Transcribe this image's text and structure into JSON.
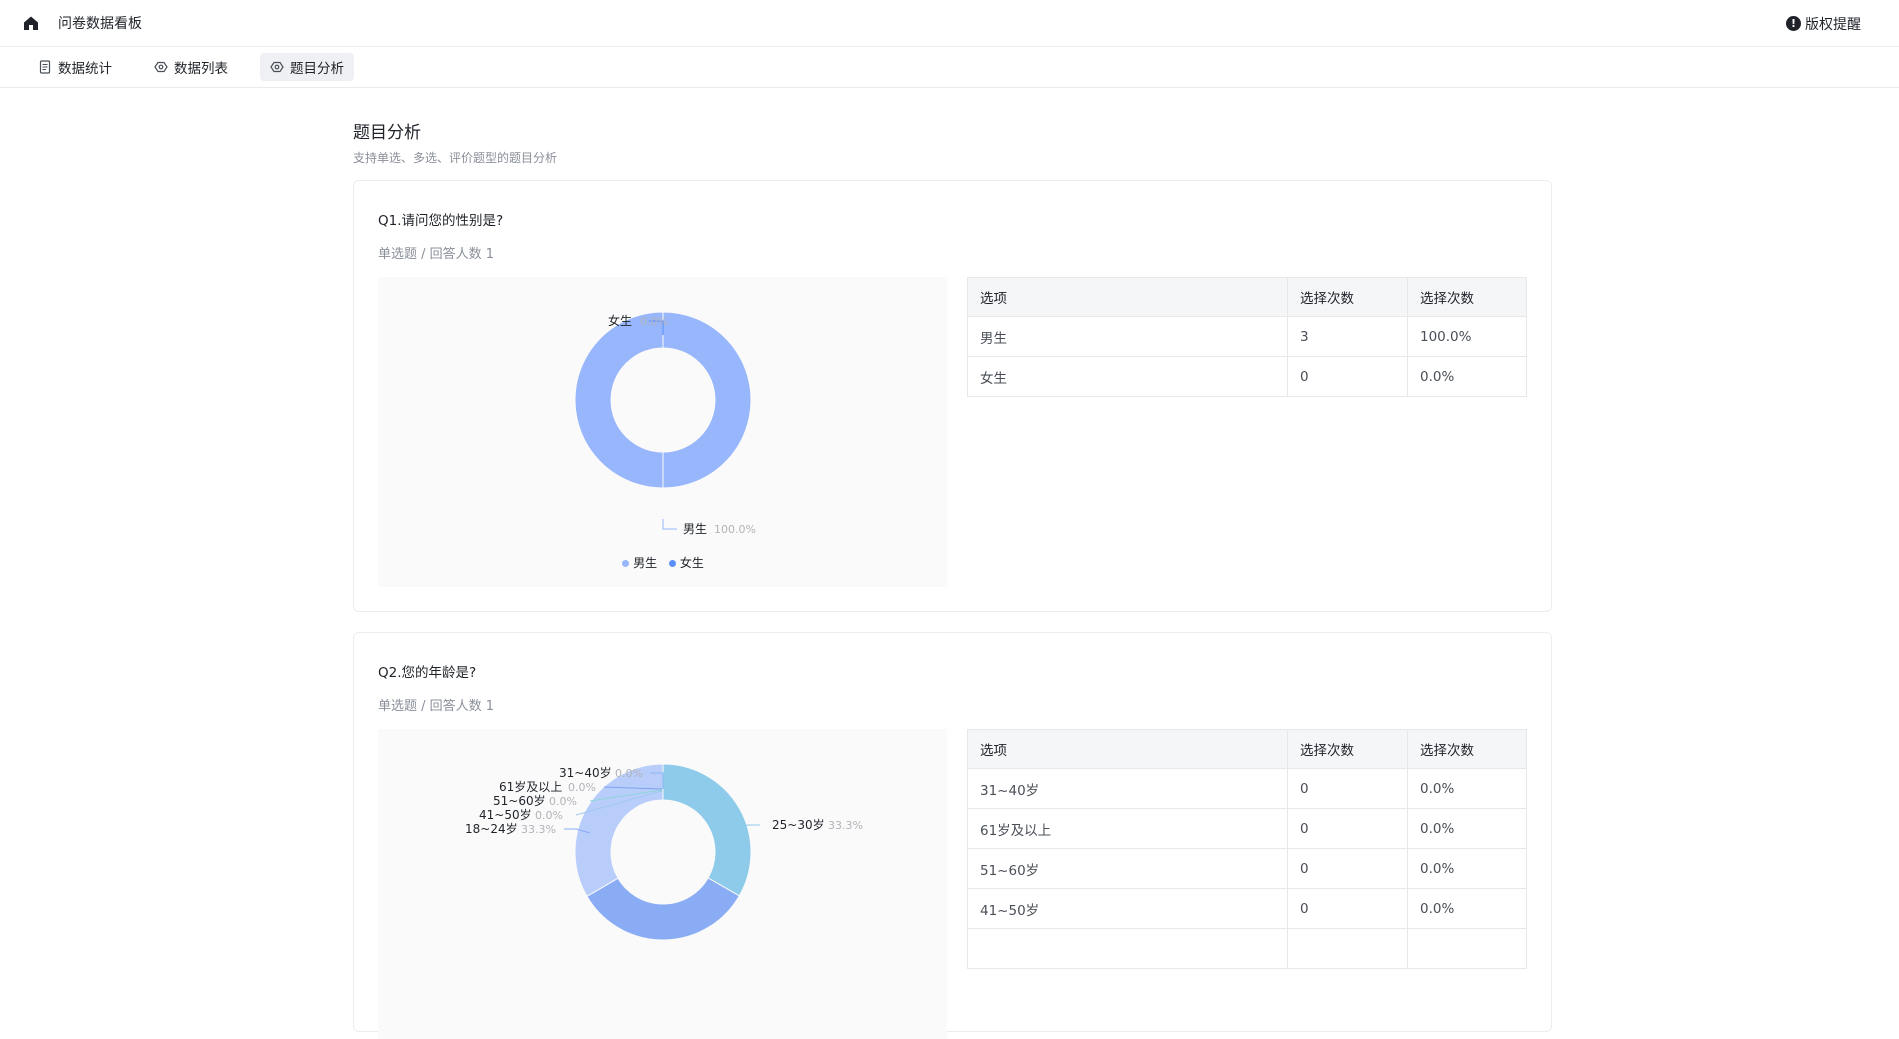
{
  "header": {
    "title": "问卷数据看板",
    "notice_label": "版权提醒",
    "notice_icon_glyph": "!"
  },
  "tabs": [
    {
      "label": "数据统计",
      "icon": "document-icon",
      "active": false
    },
    {
      "label": "数据列表",
      "icon": "eye-icon",
      "active": false
    },
    {
      "label": "题目分析",
      "icon": "eye-icon",
      "active": true
    }
  ],
  "page": {
    "title": "题目分析",
    "subtitle": "支持单选、多选、评价题型的题目分析"
  },
  "questions": [
    {
      "title": "Q1.请问您的性别是?",
      "meta": "单选题 / 回答人数 1",
      "table": {
        "headers": [
          "选项",
          "选择次数",
          "选择次数"
        ],
        "rows": [
          [
            "男生",
            "3",
            "100.0%"
          ],
          [
            "女生",
            "0",
            "0.0%"
          ]
        ]
      },
      "legend": [
        "男生",
        "女生"
      ]
    },
    {
      "title": "Q2.您的年龄是?",
      "meta": "单选题 / 回答人数 1",
      "table": {
        "headers": [
          "选项",
          "选择次数",
          "选择次数"
        ],
        "rows": [
          [
            "31~40岁",
            "0",
            "0.0%"
          ],
          [
            "61岁及以上",
            "0",
            "0.0%"
          ],
          [
            "51~60岁",
            "0",
            "0.0%"
          ],
          [
            "41~50岁",
            "0",
            "0.0%"
          ]
        ]
      }
    }
  ],
  "chart_data": [
    {
      "type": "pie",
      "slices": [
        {
          "name": "男生",
          "value": 100.0,
          "label": "100.0%",
          "color": "#97b6fb"
        },
        {
          "name": "女生",
          "value": 0.0,
          "label": "0.0%",
          "color": "#5b8ff9"
        }
      ],
      "legend": "bottom"
    },
    {
      "type": "pie",
      "slices": [
        {
          "name": "25~30岁",
          "value": 33.3,
          "label": "33.3%",
          "color": "#8ecbea"
        },
        {
          "name": "18~24岁",
          "value": 33.3,
          "label": "33.3%",
          "color": "#89acf5"
        },
        {
          "name": "41~50岁",
          "value": 0.0,
          "label": "0.0%",
          "color": "#9fc9ef"
        },
        {
          "name": "51~60岁",
          "value": 0.0,
          "label": "0.0%",
          "color": "#8fd5d8"
        },
        {
          "name": "61岁及以上",
          "value": 0.0,
          "label": "0.0%",
          "color": "#7aa2f2"
        },
        {
          "name": "31~40岁",
          "value": 0.0,
          "label": "0.0%",
          "color": "#8ab8f0"
        }
      ],
      "extra_slice_color": "#b9cdfb"
    }
  ]
}
